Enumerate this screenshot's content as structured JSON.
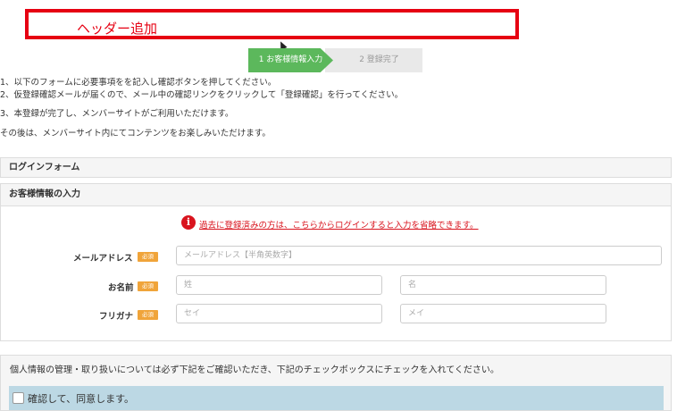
{
  "header": {
    "label": "ヘッダー追加",
    "accent": "#e60012"
  },
  "steps": [
    {
      "label": "1 お客様情報入力",
      "state": "active",
      "color": "#5cb85c"
    },
    {
      "label": "2 登録完了",
      "state": "inactive"
    }
  ],
  "instructions": [
    "1、以下のフォームに必要事項をを記入し確認ボタンを押してください。",
    "2、仮登録確認メールが届くので、メール中の確認リンクをクリックして「登録確認」を行ってください。",
    "3、本登録が完了し、メンバーサイトがご利用いただけます。",
    "その後は、メンバーサイト内にてコンテンツをお楽しみいただけます。"
  ],
  "panels": {
    "login": "ログインフォーム",
    "customer": "お客様情報の入力"
  },
  "notice": {
    "icon": "info-icon",
    "text": "過去に登録済みの方は、こちらからログインすると入力を省略できます。",
    "color": "#d9141e"
  },
  "form": {
    "required_badge": "必須",
    "email": {
      "label": "メールアドレス",
      "placeholder": "メールアドレス【半角英数字】"
    },
    "name": {
      "label": "お名前",
      "last_placeholder": "姓",
      "first_placeholder": "名"
    },
    "furigana": {
      "label": "フリガナ",
      "last_placeholder": "セイ",
      "first_placeholder": "メイ"
    }
  },
  "privacy": {
    "text": "個人情報の管理・取り扱いについては必ず下記をご確認いただき、下記のチェックボックスにチェックを入れてください。",
    "consent_label": "確認して、同意します。",
    "consent_checked": false
  }
}
